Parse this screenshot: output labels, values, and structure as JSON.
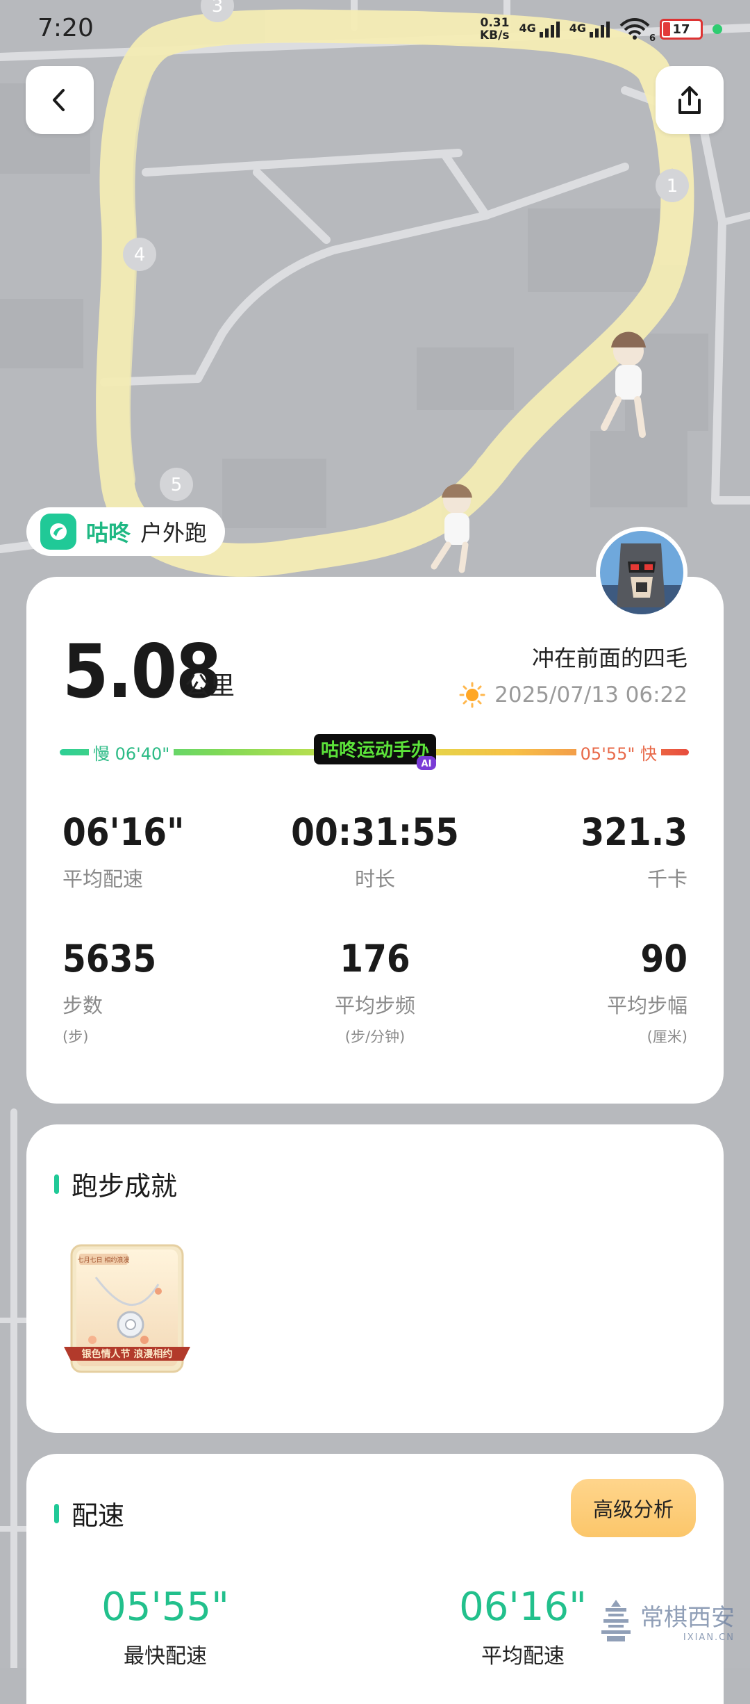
{
  "status_bar": {
    "time": "7:20",
    "net_speed_value": "0.31",
    "net_speed_unit": "KB/s",
    "signal_1_label": "4G",
    "signal_2_label": "4G",
    "wifi_badge": "6",
    "battery_level": "17"
  },
  "map": {
    "markers": [
      "1",
      "3",
      "4",
      "5"
    ]
  },
  "app_badge": {
    "brand": "咕咚",
    "activity": "户外跑"
  },
  "summary": {
    "distance": "5.08",
    "distance_unit": "公里",
    "user_name": "冲在前面的四毛",
    "datetime": "2025/07/13 06:22",
    "pace_slow_label": "慢 06'40\"",
    "pace_fast_label": "05'55\" 快",
    "logo_text": "咕咚运动手办",
    "logo_tag": "AI"
  },
  "stats": [
    {
      "value": "06'16\"",
      "label": "平均配速",
      "unit": ""
    },
    {
      "value": "00:31:55",
      "label": "时长",
      "unit": ""
    },
    {
      "value": "321.3",
      "label": "千卡",
      "unit": ""
    },
    {
      "value": "5635",
      "label": "步数",
      "unit": "(步)"
    },
    {
      "value": "176",
      "label": "平均步频",
      "unit": "(步/分钟)"
    },
    {
      "value": "90",
      "label": "平均步幅",
      "unit": "(厘米)"
    }
  ],
  "achievements": {
    "title": "跑步成就",
    "medal_banner": "银色情人节 浪漫相约",
    "medal_tag": "七月七日 相约浪漫"
  },
  "pace_section": {
    "title": "配速",
    "advanced_button": "高级分析",
    "fastest_value": "05'55\"",
    "fastest_label": "最快配速",
    "average_value": "06'16\"",
    "average_label": "平均配速"
  },
  "watermark": {
    "site_name": "常棋西安",
    "site_url": "IXIAN.CN"
  },
  "colors": {
    "accent_green": "#20c997",
    "route_yellow": "#f4ecb4",
    "fast_red": "#e84c3d"
  }
}
